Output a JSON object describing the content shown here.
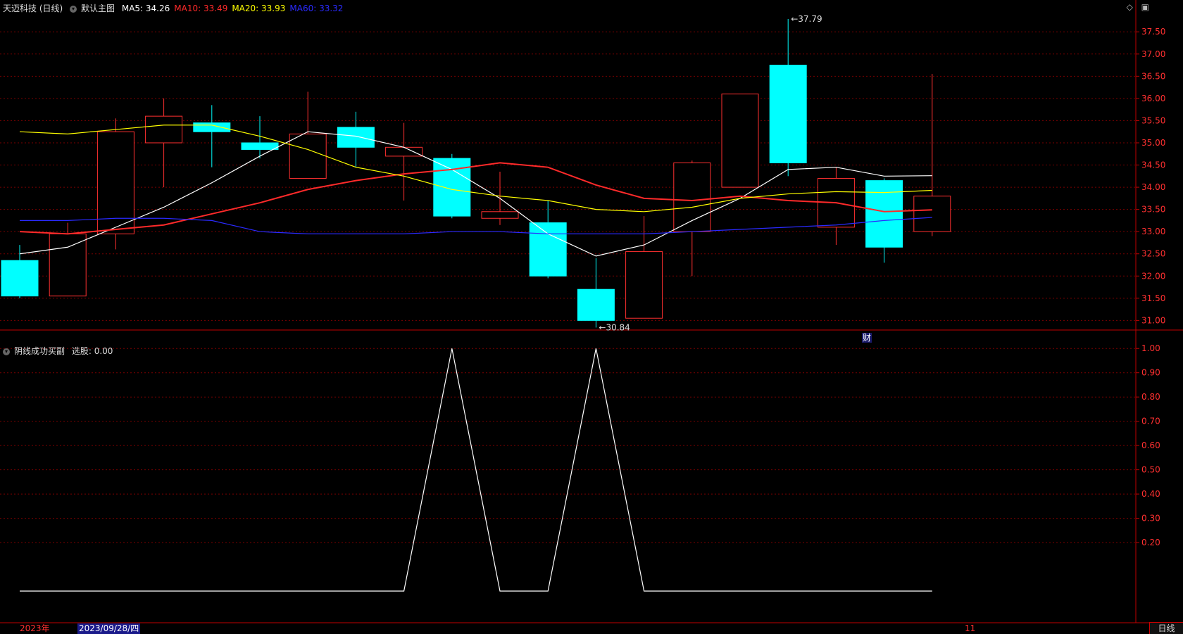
{
  "header": {
    "stock_name": "天迈科技 (日线)",
    "main_chart_label": "默认主图",
    "ma_values": [
      {
        "label": "MA5: 34.26",
        "color": "#ffffff"
      },
      {
        "label": "MA10: 33.49",
        "color": "#ff2a2a"
      },
      {
        "label": "MA20: 33.93",
        "color": "#ffff00"
      },
      {
        "label": "MA60: 33.32",
        "color": "#2a2aff"
      }
    ]
  },
  "indicator_header": {
    "name": "阴线成功买副",
    "value_label": "选股: 0.00"
  },
  "icons": [
    "diamond-icon",
    "window-icon"
  ],
  "footer": {
    "year_label": "2023年",
    "date_label": "2023/09/28/四",
    "end_label": "11",
    "period_button": "日线"
  },
  "finance_marker": "财",
  "colors": {
    "up": "#ff3030",
    "down": "#00ffff",
    "grid": "#7a0000",
    "ma5": "#ffffff",
    "ma10": "#ff2a2a",
    "ma20": "#ffff00",
    "ma60": "#2a2aff"
  },
  "chart_data": [
    {
      "type": "candlestick",
      "ylim": [
        30.8,
        37.9
      ],
      "y_ticks": [
        31.0,
        31.5,
        32.0,
        32.5,
        33.0,
        33.5,
        34.0,
        34.5,
        35.0,
        35.5,
        36.0,
        36.5,
        37.0,
        37.5
      ],
      "y_tick_labels": [
        "31.00",
        "31.50",
        "32.00",
        "32.50",
        "33.00",
        "33.50",
        "34.00",
        "34.50",
        "35.00",
        "35.50",
        "36.00",
        "36.50",
        "37.00",
        "37.50"
      ],
      "candles": [
        {
          "o": 32.35,
          "h": 32.7,
          "l": 31.5,
          "c": 31.55
        },
        {
          "o": 31.55,
          "h": 33.2,
          "l": 31.55,
          "c": 32.95
        },
        {
          "o": 32.95,
          "h": 35.55,
          "l": 32.6,
          "c": 35.25
        },
        {
          "o": 35.0,
          "h": 36.0,
          "l": 34.0,
          "c": 35.6
        },
        {
          "o": 35.45,
          "h": 35.85,
          "l": 34.45,
          "c": 35.25
        },
        {
          "o": 35.0,
          "h": 35.6,
          "l": 34.65,
          "c": 34.85
        },
        {
          "o": 34.2,
          "h": 36.15,
          "l": 34.2,
          "c": 35.2
        },
        {
          "o": 35.35,
          "h": 35.7,
          "l": 34.45,
          "c": 34.9
        },
        {
          "o": 34.7,
          "h": 35.45,
          "l": 33.7,
          "c": 34.9
        },
        {
          "o": 34.65,
          "h": 34.75,
          "l": 33.3,
          "c": 33.35
        },
        {
          "o": 33.3,
          "h": 34.35,
          "l": 33.15,
          "c": 33.45
        },
        {
          "o": 33.2,
          "h": 33.7,
          "l": 31.95,
          "c": 32.0
        },
        {
          "o": 31.7,
          "h": 32.4,
          "l": 30.84,
          "c": 31.0
        },
        {
          "o": 31.05,
          "h": 33.35,
          "l": 31.05,
          "c": 32.55
        },
        {
          "o": 33.0,
          "h": 34.6,
          "l": 32.0,
          "c": 34.55
        },
        {
          "o": 34.0,
          "h": 36.1,
          "l": 34.0,
          "c": 36.1
        },
        {
          "o": 36.75,
          "h": 37.79,
          "l": 34.25,
          "c": 34.55
        },
        {
          "o": 33.1,
          "h": 34.45,
          "l": 32.7,
          "c": 34.2
        },
        {
          "o": 34.15,
          "h": 34.2,
          "l": 32.3,
          "c": 32.65
        },
        {
          "o": 33.0,
          "h": 36.55,
          "l": 32.9,
          "c": 33.8
        }
      ],
      "annotations": [
        {
          "label": "37.79",
          "index": 16,
          "value": 37.79
        },
        {
          "label": "30.84",
          "index": 12,
          "value": 30.84
        }
      ],
      "series": [
        {
          "name": "MA5",
          "color": "#ffffff",
          "values": [
            32.5,
            32.65,
            33.1,
            33.55,
            34.1,
            34.7,
            35.25,
            35.15,
            34.9,
            34.4,
            33.75,
            32.95,
            32.45,
            32.7,
            33.25,
            33.75,
            34.4,
            34.45,
            34.25,
            34.26
          ]
        },
        {
          "name": "MA10",
          "color": "#ff2a2a",
          "values": [
            33.0,
            32.95,
            33.05,
            33.15,
            33.4,
            33.65,
            33.95,
            34.15,
            34.3,
            34.4,
            34.55,
            34.45,
            34.05,
            33.75,
            33.7,
            33.8,
            33.7,
            33.65,
            33.45,
            33.49
          ]
        },
        {
          "name": "MA20",
          "color": "#ffff00",
          "values": [
            35.25,
            35.2,
            35.3,
            35.4,
            35.4,
            35.15,
            34.85,
            34.45,
            34.25,
            33.95,
            33.8,
            33.7,
            33.5,
            33.45,
            33.55,
            33.75,
            33.85,
            33.9,
            33.88,
            33.93
          ]
        },
        {
          "name": "MA60",
          "color": "#2a2aff",
          "values": [
            33.25,
            33.25,
            33.3,
            33.3,
            33.25,
            33.0,
            32.95,
            32.95,
            32.95,
            33.0,
            33.0,
            32.95,
            32.95,
            32.95,
            33.0,
            33.05,
            33.1,
            33.15,
            33.25,
            33.32
          ]
        }
      ]
    },
    {
      "type": "line",
      "ylim": [
        0.0,
        1.05
      ],
      "y_ticks": [
        0.2,
        0.3,
        0.4,
        0.5,
        0.6,
        0.7,
        0.8,
        0.9,
        1.0
      ],
      "y_tick_labels": [
        "0.20",
        "0.30",
        "0.40",
        "0.50",
        "0.60",
        "0.70",
        "0.80",
        "0.90",
        "1.00"
      ],
      "series": [
        {
          "name": "选股",
          "color": "#ffffff",
          "values": [
            0,
            0,
            0,
            0,
            0,
            0,
            0,
            0,
            0,
            1,
            0,
            0,
            1,
            0,
            0,
            0,
            0,
            0,
            0,
            0
          ]
        }
      ]
    }
  ]
}
